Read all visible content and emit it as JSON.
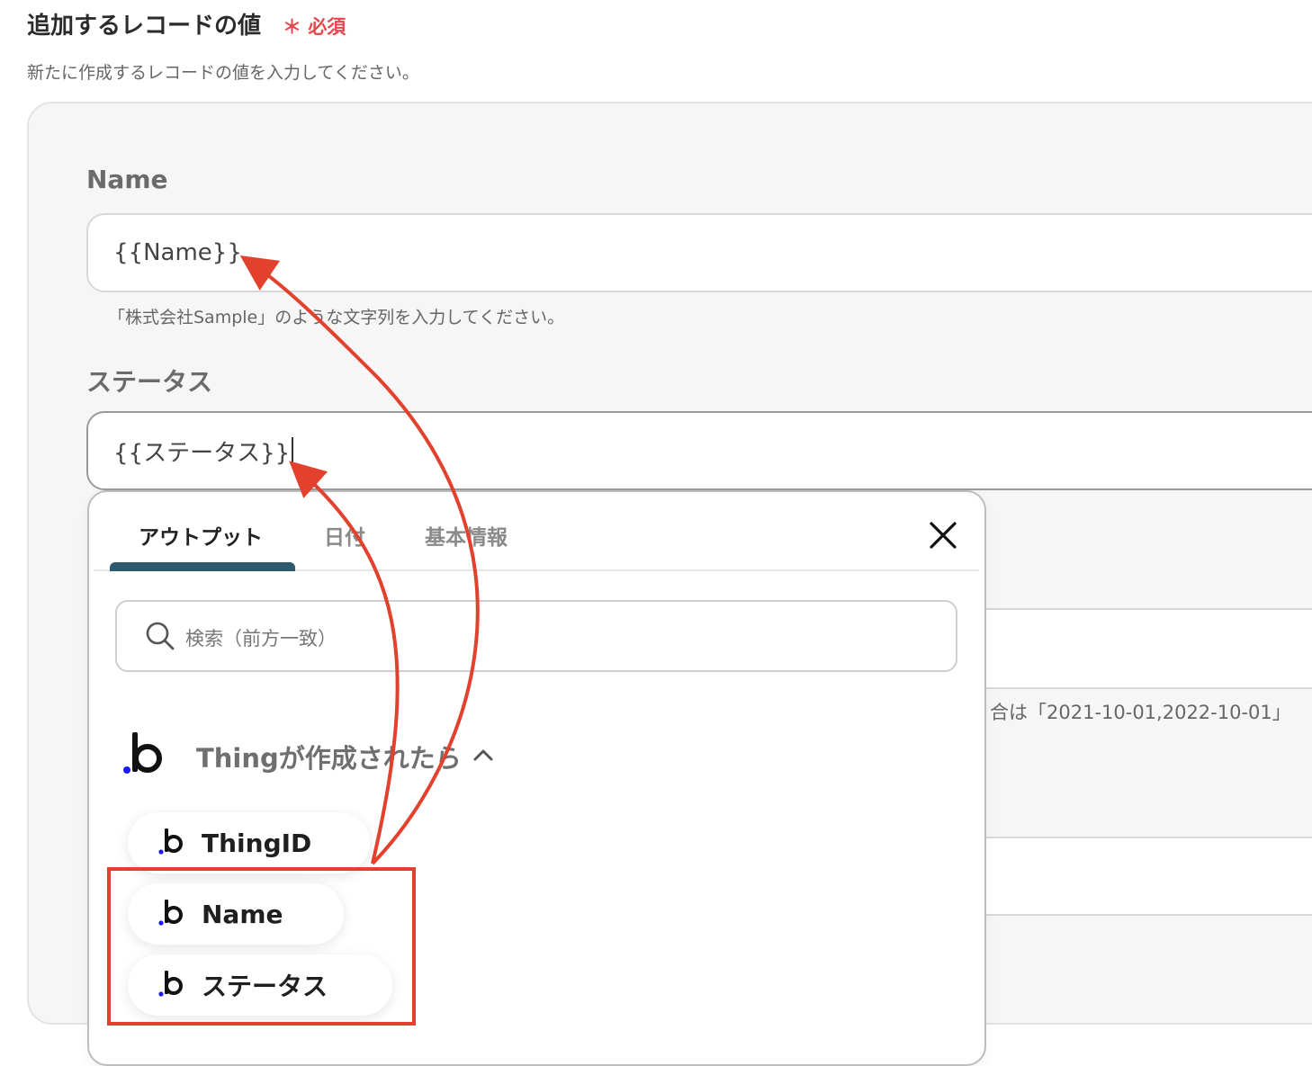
{
  "section": {
    "title": "追加するレコードの値",
    "required_mark": "＊",
    "required_label": "必須",
    "description": "新たに作成するレコードの値を入力してください。"
  },
  "fields": {
    "name": {
      "label": "Name",
      "value": "{{Name}}",
      "hint": "「株式会社Sample」のような文字列を入力してください。"
    },
    "status": {
      "label": "ステータス",
      "value": "{{ステータス}}"
    },
    "partial_hint": "合は「2021-10-01,2022-10-01」"
  },
  "popup": {
    "tabs": [
      {
        "label": "アウトプット",
        "active": true
      },
      {
        "label": "日付",
        "active": false
      },
      {
        "label": "基本情報",
        "active": false
      }
    ],
    "search_placeholder": "検索（前方一致）",
    "group": {
      "title": "Thingが作成されたら",
      "items": [
        {
          "label": "ThingID"
        },
        {
          "label": "Name"
        },
        {
          "label": "ステータス"
        }
      ]
    }
  },
  "icons": {
    "app_logo": "bubble-logo-icon",
    "close": "close-icon",
    "search": "search-icon",
    "collapse": "chevron-up-icon"
  },
  "colors": {
    "required": "#e5484d",
    "active_tab": "#2e5a6e",
    "annotation": "#e2412e",
    "logo_dot": "#1a1aff"
  }
}
